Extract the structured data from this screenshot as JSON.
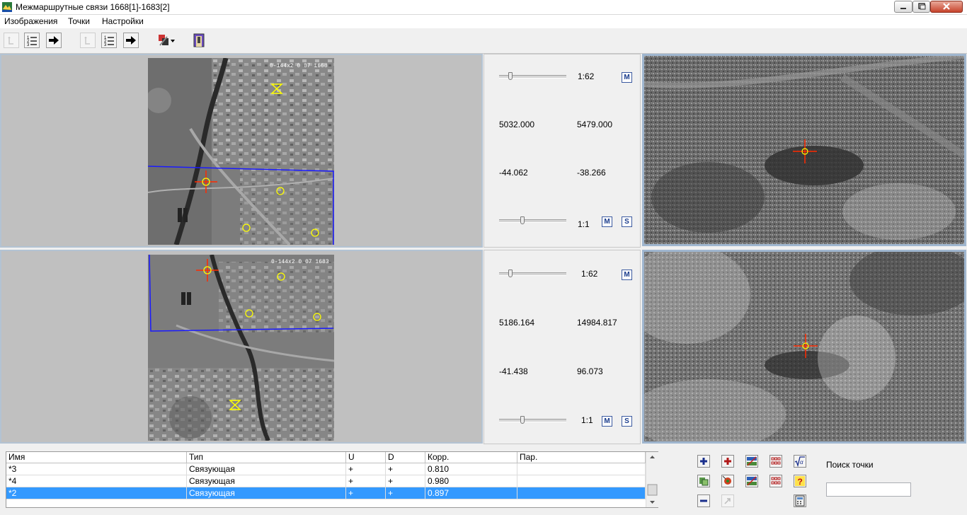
{
  "window": {
    "title": "Межмаршрутные связи 1668[1]-1683[2]"
  },
  "menu": {
    "items": [
      "Изображения",
      "Точки",
      "Настройки"
    ]
  },
  "icons": {
    "app": "app-icon",
    "toolbar": [
      "pointer-icon",
      "list-icon",
      "arrow-right-icon",
      "pointer-icon",
      "list-icon",
      "arrow-right-icon",
      "tools-dropdown-icon",
      "door-icon"
    ]
  },
  "top_panel": {
    "image_label": "0-144x2 0 07 1668",
    "scale_top": "1:62",
    "coord_x": "5032.000",
    "coord_y": "5479.000",
    "offset_x": "-44.062",
    "offset_y": "-38.266",
    "scale_bottom": "1:1",
    "m_label": "M",
    "s_label": "S"
  },
  "bottom_panel": {
    "image_label": "0-144x2 0 07 1683",
    "scale_top": "1:62",
    "coord_x": "5186.164",
    "coord_y": "14984.817",
    "offset_x": "-41.438",
    "offset_y": "96.073",
    "scale_bottom": "1:1",
    "m_label": "M",
    "s_label": "S"
  },
  "table": {
    "columns": [
      "Имя",
      "Тип",
      "U",
      "D",
      "Корр.",
      "Пар."
    ],
    "rows": [
      {
        "name": "*3",
        "type": "Связующая",
        "u": "+",
        "d": "+",
        "corr": "0.810",
        "par": ""
      },
      {
        "name": "*4",
        "type": "Связующая",
        "u": "+",
        "d": "+",
        "corr": "0.980",
        "par": ""
      },
      {
        "name": "*2",
        "type": "Связующая",
        "u": "+",
        "d": "+",
        "corr": "0.897",
        "par": ""
      }
    ],
    "selected_row": 2
  },
  "search": {
    "label": "Поиск точки",
    "value": ""
  },
  "colors": {
    "selection": "#3399ff",
    "crosshair": "#ff2a00",
    "marker": "#ffff00",
    "region_outline": "#1a1aff"
  }
}
